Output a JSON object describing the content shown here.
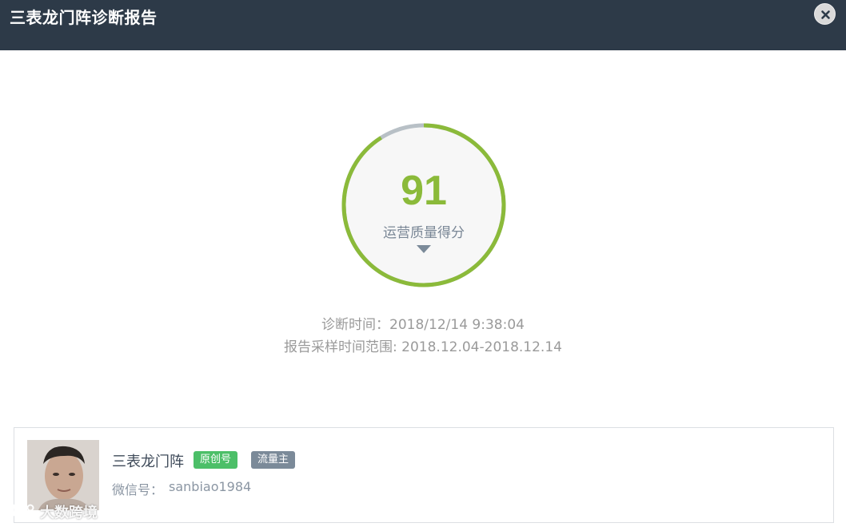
{
  "window": {
    "title": "三表龙门阵诊断报告",
    "close_icon": "close-icon"
  },
  "score": {
    "value": "91",
    "label": "运营质量得分",
    "percent": 91,
    "ring_color": "#8bba3a",
    "track_color": "#b8c0c6",
    "expand_icon": "caret-down-icon"
  },
  "diagnosis": {
    "time_line": "诊断时间：2018/12/14 9:38:04",
    "range_line": "报告采样时间范围: 2018.12.04-2018.12.14"
  },
  "account": {
    "name": "三表龙门阵",
    "badges": [
      "原创号",
      "流量主"
    ],
    "wechat_label": "微信号：",
    "wechat_id": "sanbiao1984"
  },
  "watermark": {
    "text": "大数跨境"
  }
}
